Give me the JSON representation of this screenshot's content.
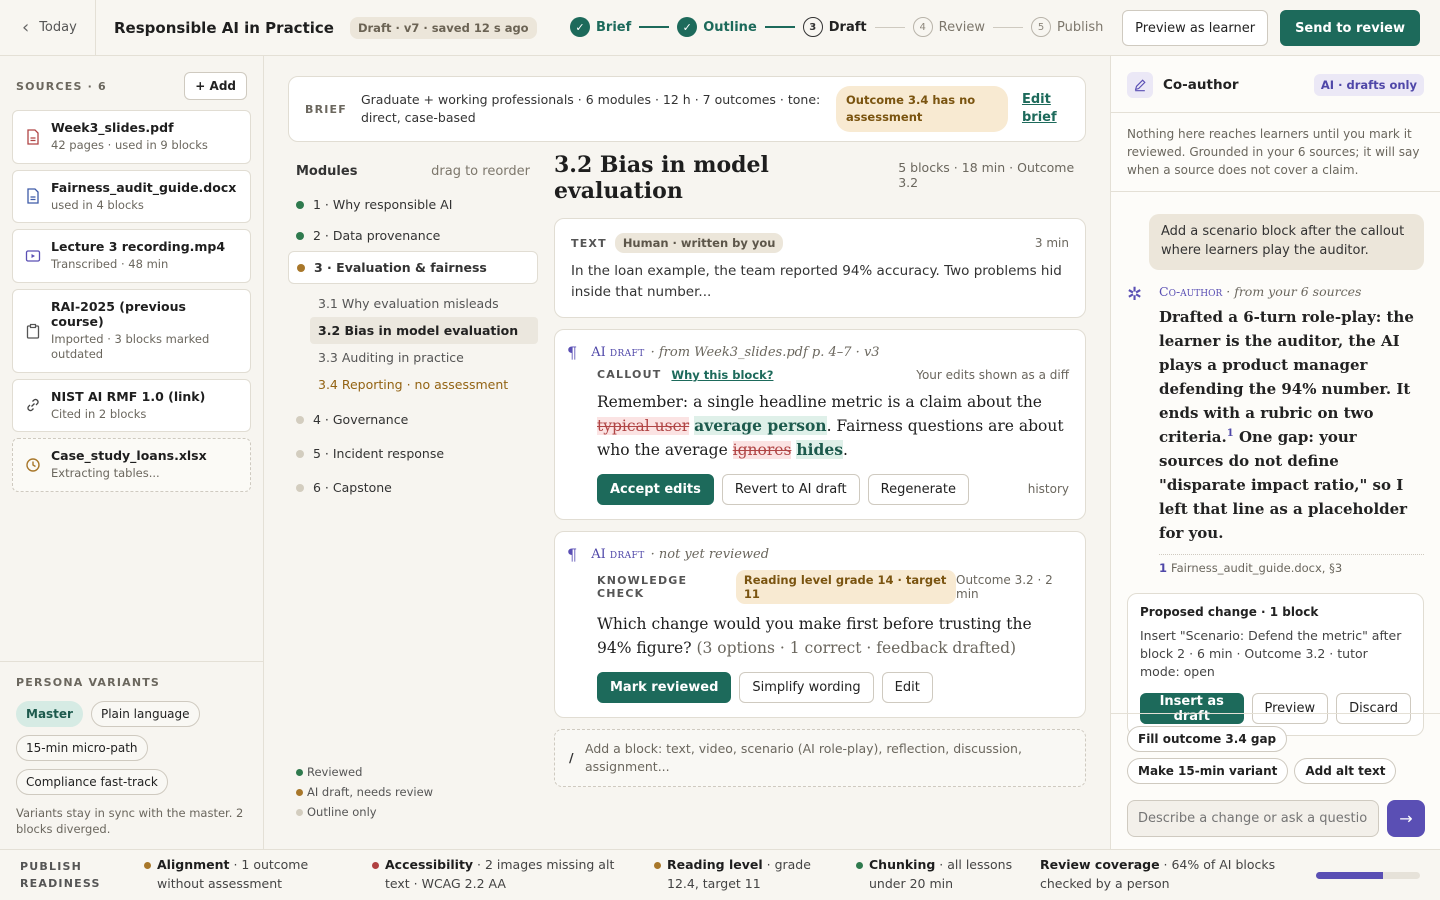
{
  "topbar": {
    "back_label": "Today",
    "course_title": "Responsible AI in Practice",
    "draft_status": "Draft · v7 · saved 12 s ago",
    "steps": [
      {
        "num": "✓",
        "label": "Brief",
        "state": "done"
      },
      {
        "num": "✓",
        "label": "Outline",
        "state": "done"
      },
      {
        "num": "3",
        "label": "Draft",
        "state": "current"
      },
      {
        "num": "4",
        "label": "Review",
        "state": "future"
      },
      {
        "num": "5",
        "label": "Publish",
        "state": "future"
      }
    ],
    "preview_label": "Preview as learner",
    "send_label": "Send to review"
  },
  "sources": {
    "heading": "SOURCES · 6",
    "add_label": "+ Add",
    "items": [
      {
        "name": "Week3_slides.pdf",
        "meta": "42 pages · used in 9 blocks",
        "icon": "pdf-icon"
      },
      {
        "name": "Fairness_audit_guide.docx",
        "meta": "used in 4 blocks",
        "icon": "doc-icon"
      },
      {
        "name": "Lecture 3 recording.mp4",
        "meta": "Transcribed · 48 min",
        "icon": "video-icon"
      },
      {
        "name": "RAI-2025 (previous course)",
        "meta": "Imported · 3 blocks marked outdated",
        "icon": "clipboard-icon"
      },
      {
        "name": "NIST AI RMF 1.0 (link)",
        "meta": "Cited in 2 blocks",
        "icon": "link-icon"
      },
      {
        "name": "Case_study_loans.xlsx",
        "meta": "Extracting tables...",
        "icon": "clock-icon"
      }
    ]
  },
  "persona": {
    "heading": "PERSONA VARIANTS",
    "chips": [
      "Master",
      "Plain language",
      "15-min micro-path",
      "Compliance fast-track"
    ],
    "note": "Variants stay in sync with the master. 2 blocks diverged."
  },
  "brief": {
    "label": "BRIEF",
    "text": "Graduate + working professionals · 6 modules · 12 h · 7 outcomes · tone: direct, case-based",
    "warning": "Outcome 3.4 has no assessment",
    "edit_label": "Edit brief"
  },
  "modules": {
    "heading": "Modules",
    "hint": "drag to reorder",
    "items": [
      {
        "label": "1 · Why responsible AI",
        "status": "reviewed"
      },
      {
        "label": "2 · Data provenance",
        "status": "reviewed"
      },
      {
        "label": "3 · Evaluation & fairness",
        "status": "needs-review"
      },
      {
        "label": "4 · Governance",
        "status": "outline"
      },
      {
        "label": "5 · Incident response",
        "status": "outline"
      },
      {
        "label": "6 · Capstone",
        "status": "outline"
      }
    ],
    "subs": [
      "3.1 Why evaluation misleads",
      "3.2 Bias in model evaluation",
      "3.3 Auditing in practice",
      "3.4 Reporting · no assessment"
    ],
    "legend": [
      "Reviewed",
      "AI draft, needs review",
      "Outline only"
    ],
    "colors": {
      "reviewed": "#2f7a4e",
      "needs-review": "#a8772a",
      "outline": "#d3cdbf"
    }
  },
  "lesson": {
    "title": "3.2 Bias in model evaluation",
    "meta": "5 blocks · 18 min · Outcome 3.2",
    "text_block": {
      "kind": "TEXT",
      "tag": "Human · written by you",
      "duration": "3 min",
      "body": "In the loan example, the team reported 94% accuracy. Two problems hid inside that number..."
    },
    "callout_block": {
      "ai": "AI",
      "draft": "draft",
      "source": "· from Week3_slides.pdf p. 4–7 · v3",
      "kind": "CALLOUT",
      "why": "Why this block?",
      "diff_note": "Your edits shown as a diff",
      "p1": "Remember: a single headline metric is a claim about the ",
      "del1": "typical user",
      "ins1": "average person",
      "p2": ". Fairness questions are about who the average ",
      "del2": "ignores",
      "ins2": "hides",
      "p3": ".",
      "accept": "Accept edits",
      "revert": "Revert to AI draft",
      "regen": "Regenerate",
      "history": "history"
    },
    "check_block": {
      "ai": "AI",
      "draft": "draft",
      "status": "· not yet reviewed",
      "kind": "KNOWLEDGE CHECK",
      "tag": "Reading level grade 14 · target 11",
      "meta": "Outcome 3.2 · 2 min",
      "question": "Which change would you make first before trusting the 94% figure?",
      "details": " (3 options · 1 correct · feedback drafted)",
      "mark": "Mark reviewed",
      "simplify": "Simplify wording",
      "edit": "Edit"
    },
    "add_block": "Add a block: text, video, scenario (AI role-play), reflection, discussion, assignment..."
  },
  "coauthor": {
    "title": "Co-author",
    "pill": "AI · drafts only",
    "note": "Nothing here reaches learners until you mark it reviewed. Grounded in your 6 sources; it will say when a source does not cover a claim.",
    "user_msg": "Add a scenario block after the callout where learners play the auditor.",
    "who": "Co-author",
    "from": "· from your 6 sources",
    "reply_a": "Drafted a 6-turn role-play: the learner is the auditor, the AI plays a product manager defending the 94% number. It ends with a rubric on two criteria.",
    "sup": "1",
    "gap": "One gap:",
    "reply_b": " your sources do not define \"disparate impact ratio,\" so I left that line as a placeholder for you.",
    "fn_num": "1",
    "fn_text": "Fairness_audit_guide.docx, §3",
    "proposal_title": "Proposed change · 1 block",
    "proposal_desc": "Insert \"Scenario: Defend the metric\" after block 2 · 6 min · Outcome 3.2 · tutor mode: open",
    "insert": "Insert as draft",
    "preview": "Preview",
    "discard": "Discard",
    "quick": [
      "Fill outcome 3.4 gap",
      "Make 15-min variant",
      "Add alt text"
    ],
    "input_placeholder": "Describe a change or ask a question."
  },
  "readiness": {
    "label": "PUBLISH READINESS",
    "items": [
      {
        "title": "Alignment",
        "text": " · 1 outcome without assessment",
        "color": "#a8772a"
      },
      {
        "title": "Accessibility",
        "text": " · 2 images missing alt text · WCAG 2.2 AA",
        "color": "#b04040"
      },
      {
        "title": "Reading level",
        "text": " · grade 12.4, target 11",
        "color": "#a8772a"
      },
      {
        "title": "Chunking",
        "text": " · all lessons under 20 min",
        "color": "#2f7a4e"
      },
      {
        "title": "Review coverage",
        "text": " · 64% of AI blocks checked by a person",
        "color": "#5a4fb4"
      }
    ],
    "coverage_fraction": 0.64
  }
}
